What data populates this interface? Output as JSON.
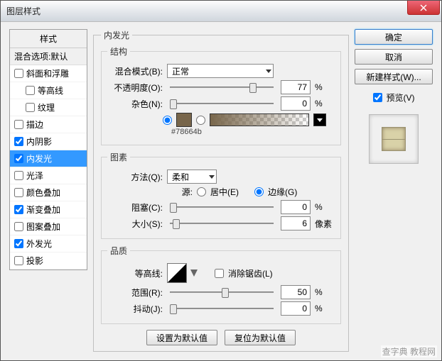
{
  "window": {
    "title": "图层样式"
  },
  "styles": {
    "header": "样式",
    "blend_default": "混合选项:默认",
    "items": [
      {
        "label": "斜面和浮雕",
        "checked": false,
        "indent": false
      },
      {
        "label": "等高线",
        "checked": false,
        "indent": true
      },
      {
        "label": "纹理",
        "checked": false,
        "indent": true
      },
      {
        "label": "描边",
        "checked": false,
        "indent": false
      },
      {
        "label": "内阴影",
        "checked": true,
        "indent": false
      },
      {
        "label": "内发光",
        "checked": true,
        "indent": false,
        "selected": true
      },
      {
        "label": "光泽",
        "checked": false,
        "indent": false
      },
      {
        "label": "颜色叠加",
        "checked": false,
        "indent": false
      },
      {
        "label": "渐变叠加",
        "checked": true,
        "indent": false
      },
      {
        "label": "图案叠加",
        "checked": false,
        "indent": false
      },
      {
        "label": "外发光",
        "checked": true,
        "indent": false
      },
      {
        "label": "投影",
        "checked": false,
        "indent": false
      }
    ]
  },
  "panel": {
    "title": "内发光",
    "group_struct": "结构",
    "blend_mode_label": "混合模式(B):",
    "blend_mode_value": "正常",
    "opacity_label": "不透明度(O):",
    "opacity_value": "77",
    "percent": "%",
    "noise_label": "杂色(N):",
    "noise_value": "0",
    "color_hex": "#78664b",
    "group_elem": "图素",
    "method_label": "方法(Q):",
    "method_value": "柔和",
    "source_label": "源:",
    "source_center": "居中(E)",
    "source_edge": "边缘(G)",
    "choke_label": "阻塞(C):",
    "choke_value": "0",
    "size_label": "大小(S):",
    "size_value": "6",
    "px": "像素",
    "group_quality": "品质",
    "contour_label": "等高线:",
    "antialias_label": "消除锯齿(L)",
    "range_label": "范围(R):",
    "range_value": "50",
    "jitter_label": "抖动(J):",
    "jitter_value": "0",
    "btn_default": "设置为默认值",
    "btn_reset": "复位为默认值"
  },
  "right": {
    "ok": "确定",
    "cancel": "取消",
    "newstyle": "新建样式(W)...",
    "preview_label": "预览(V)"
  },
  "watermark": "查字典 教程网"
}
